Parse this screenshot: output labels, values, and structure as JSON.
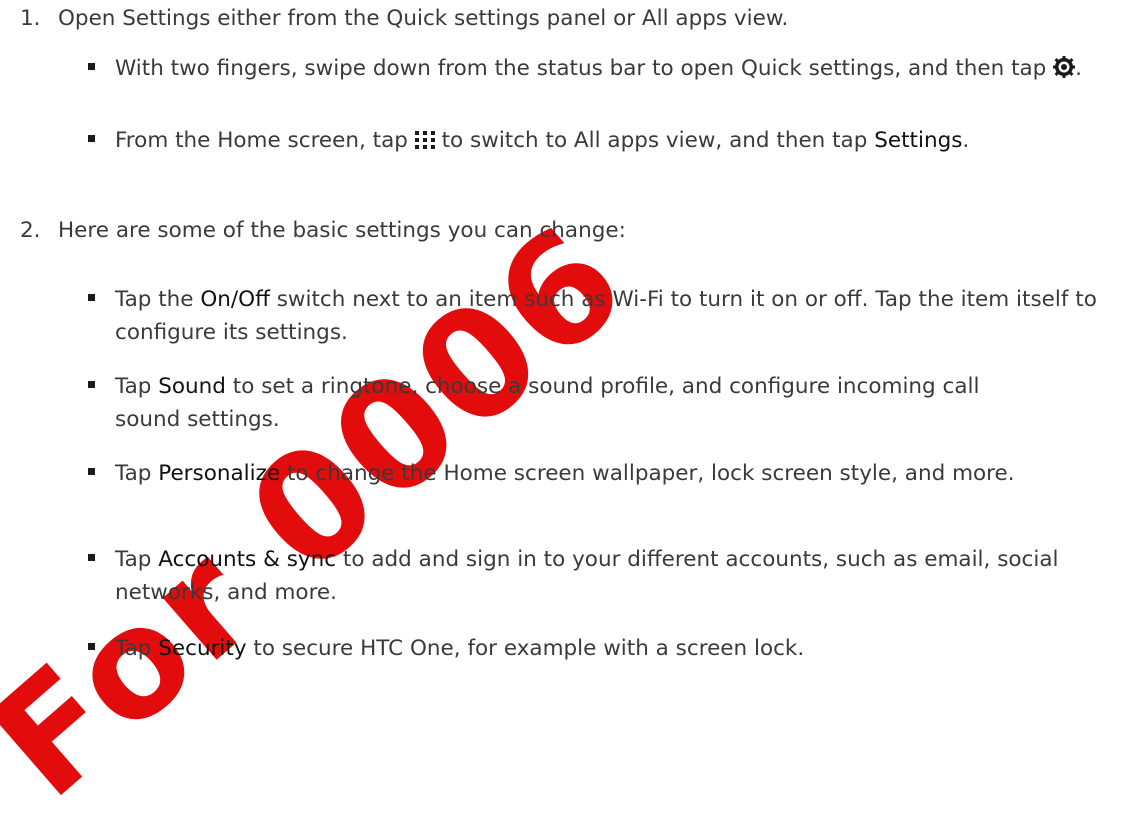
{
  "watermark": "For 0006",
  "steps": [
    {
      "number": "1.",
      "text": "Open Settings either from the Quick settings panel or All apps view.",
      "bullets": [
        {
          "before": "With two fingers, swipe down from the status bar to open Quick settings, and then tap",
          "icon": "gear-icon",
          "after": "."
        },
        {
          "before": "From the Home screen, tap",
          "icon": "apps-grid-icon",
          "after": "to switch to All apps view, and then tap",
          "term": "Settings",
          "tail": "."
        }
      ]
    },
    {
      "number": "2.",
      "text": "Here are some of the basic settings you can change:",
      "bullets": [
        {
          "before": "Tap the",
          "term": "On/Off",
          "after": "switch next to an item such as Wi-Fi to turn it on or off. Tap the item itself to configure its settings."
        },
        {
          "before": "Tap",
          "term": "Sound",
          "after": "to set a ringtone, choose a sound profile, and configure incoming call sound settings."
        },
        {
          "before": "Tap",
          "term": "Personalize",
          "after": "to change the Home screen wallpaper, lock screen style, and more."
        },
        {
          "before": "Tap",
          "term": "Accounts & sync",
          "after": "to add and sign in to your different accounts, such as email, social networks, and more."
        },
        {
          "before": "Tap",
          "term": "Security",
          "after": "to secure HTC One, for example with a screen lock."
        }
      ]
    }
  ],
  "colors": {
    "text": "#3a3a3a",
    "watermark": "#e10000"
  }
}
